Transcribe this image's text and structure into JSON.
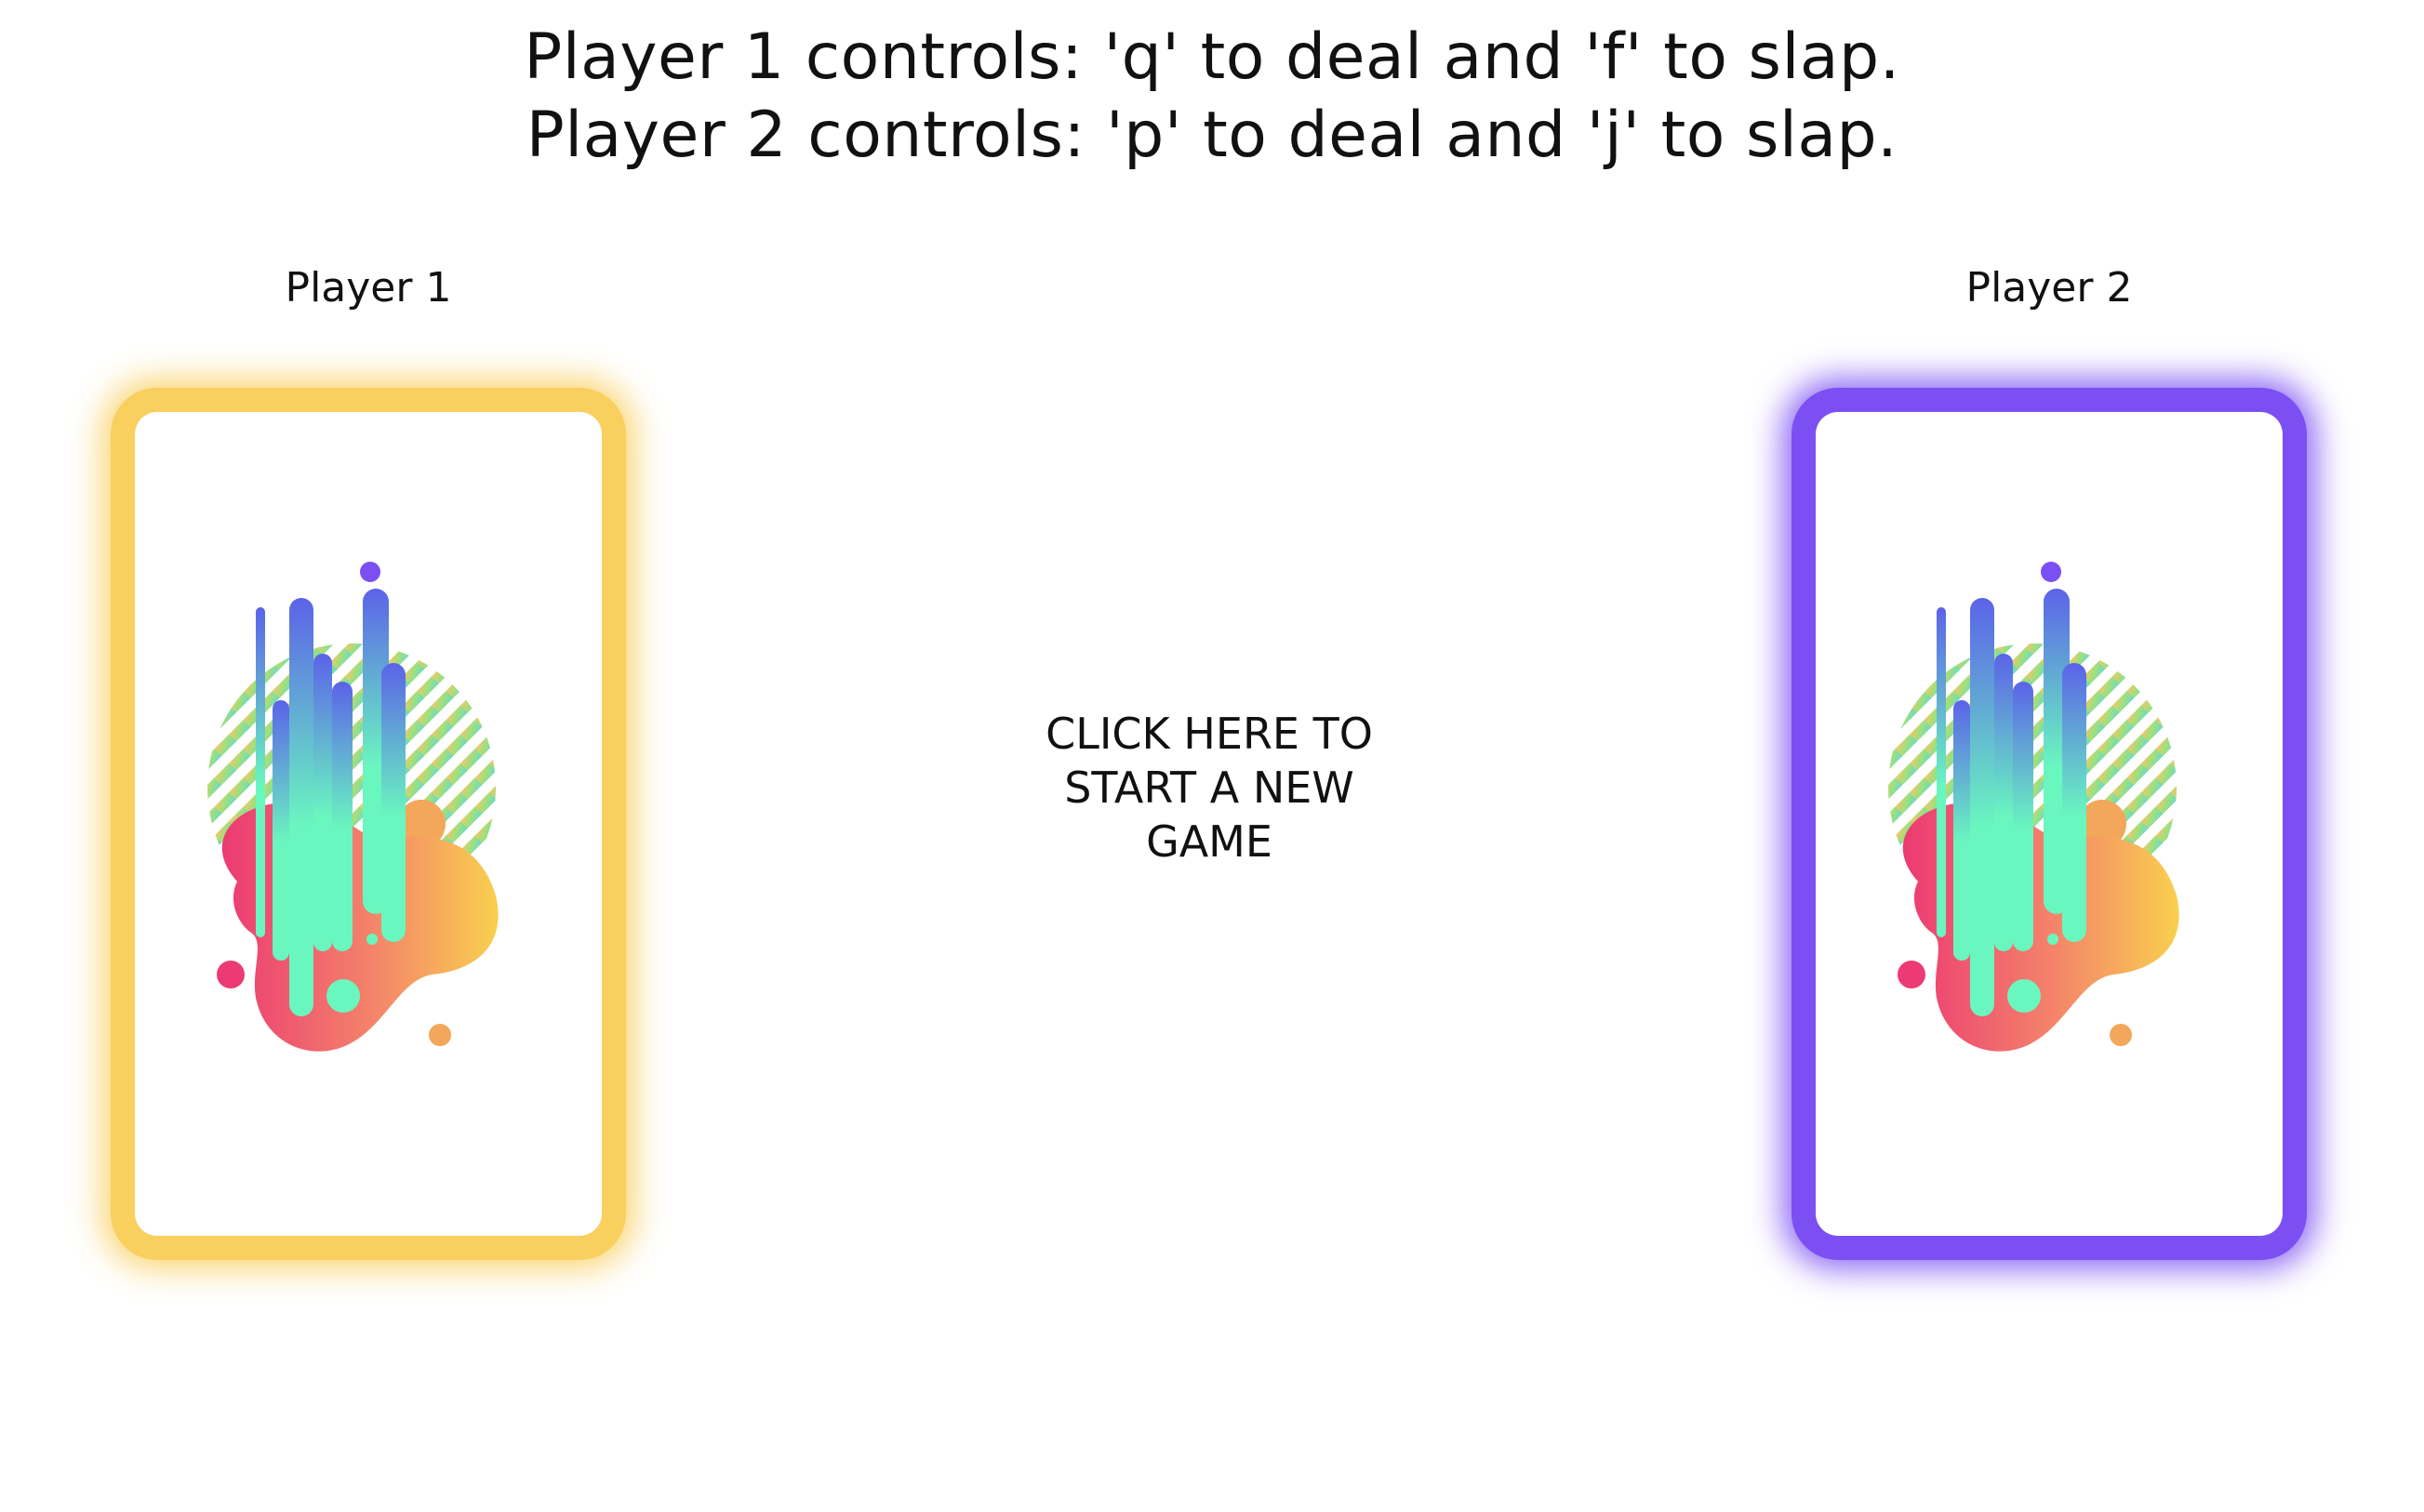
{
  "instructions": {
    "player1": "Player 1 controls: 'q' to deal and 'f' to slap.",
    "player2": "Player 2 controls: 'p' to deal and 'j' to slap."
  },
  "players": {
    "p1": {
      "label": "Player 1",
      "glow_color": "#f9cf5e"
    },
    "p2": {
      "label": "Player 2",
      "glow_color": "#7b4ff2"
    }
  },
  "start_button": {
    "line1": "CLICK HERE TO",
    "line2": "START A NEW",
    "line3": "GAME"
  },
  "card_back": {
    "icon": "abstract-paint-splash-icon"
  }
}
